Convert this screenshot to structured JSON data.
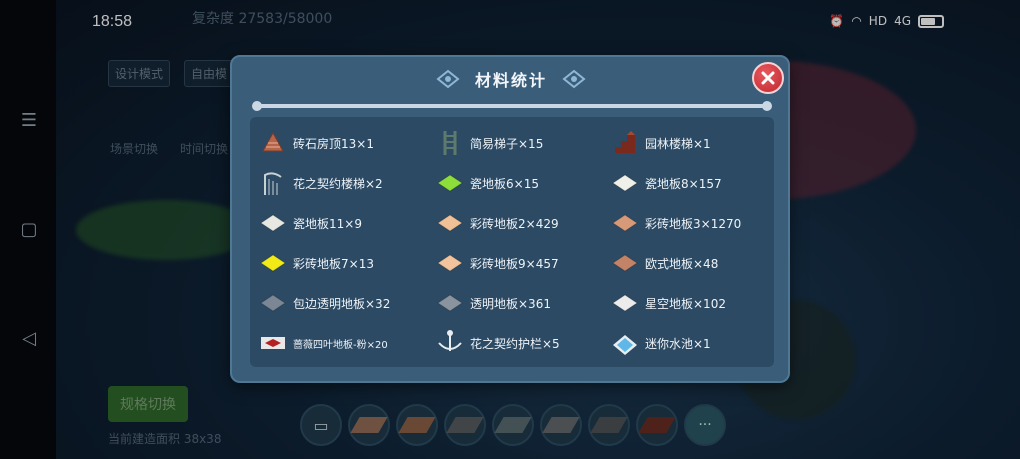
{
  "status_bar": {
    "time": "18:58",
    "network": "4G"
  },
  "background": {
    "top_label": "复杂度 27583/58000",
    "design_mode": "设计模式",
    "free_mode": "自由模",
    "scene_switch": "场景切换",
    "time_switch": "时间切换",
    "scale_switch": "规格切换",
    "area": "当前建造面积 38x38"
  },
  "modal": {
    "title": "材料统计",
    "items": [
      {
        "label": "砖石房顶13×1",
        "icon": "brick-roof-icon",
        "color": "#b5654a"
      },
      {
        "label": "简易梯子×15",
        "icon": "ladder-icon",
        "color": "#5e7a6c"
      },
      {
        "label": "园林楼梯×1",
        "icon": "garden-stairs-icon",
        "color": "#7a2a1c"
      },
      {
        "label": "花之契约楼梯×2",
        "icon": "flower-stairs-icon",
        "color": "#c8d2d6"
      },
      {
        "label": "瓷地板6×15",
        "icon": "floor-tile-icon",
        "color": "#8ede3b"
      },
      {
        "label": "瓷地板8×157",
        "icon": "floor-tile-icon",
        "color": "#f0f0ea"
      },
      {
        "label": "瓷地板11×9",
        "icon": "floor-tile-icon",
        "color": "#e8e8e2"
      },
      {
        "label": "彩砖地板2×429",
        "icon": "floor-tile-icon",
        "color": "#f0c096"
      },
      {
        "label": "彩砖地板3×1270",
        "icon": "floor-tile-icon",
        "color": "#d79a78"
      },
      {
        "label": "彩砖地板7×13",
        "icon": "floor-tile-icon",
        "color": "#f1ea17"
      },
      {
        "label": "彩砖地板9×457",
        "icon": "floor-tile-icon",
        "color": "#f2c39c"
      },
      {
        "label": "欧式地板×48",
        "icon": "floor-tile-icon",
        "color": "#c38366"
      },
      {
        "label": "包边透明地板×32",
        "icon": "floor-tile-icon",
        "color": "#7b8794"
      },
      {
        "label": "透明地板×361",
        "icon": "floor-tile-icon",
        "color": "#8a949e"
      },
      {
        "label": "星空地板×102",
        "icon": "floor-tile-icon",
        "color": "#ececec"
      },
      {
        "label": "蔷薇四叶地板-粉×20",
        "icon": "rose-floor-icon",
        "color": "#b32222",
        "small": true
      },
      {
        "label": "花之契约护栏×5",
        "icon": "flower-fence-icon",
        "color": "#e8eef0"
      },
      {
        "label": "迷你水池×1",
        "icon": "mini-pool-icon",
        "color": "#5fb7e8"
      }
    ]
  },
  "toolbar": {
    "more": "···"
  }
}
